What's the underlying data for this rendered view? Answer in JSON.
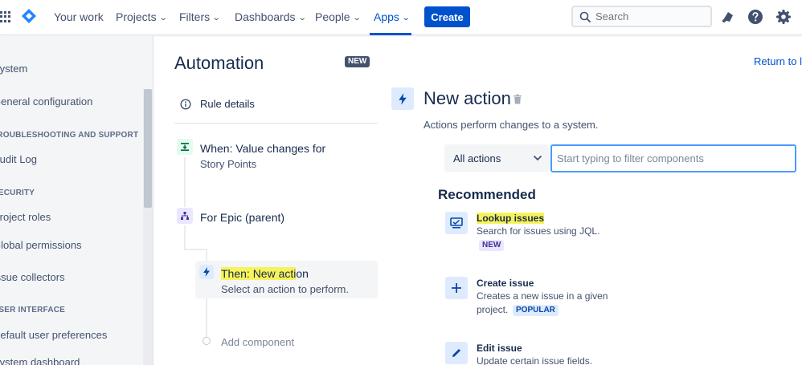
{
  "nav": {
    "your_work": "Your work",
    "projects": "Projects",
    "filters": "Filters",
    "dashboards": "Dashboards",
    "people": "People",
    "apps": "Apps",
    "create": "Create",
    "search_placeholder": "Search",
    "accent": "#0052cc"
  },
  "sidebar": {
    "title": "System",
    "items": [
      {
        "label": "General configuration"
      },
      {
        "section": "TROUBLESHOOTING AND SUPPORT"
      },
      {
        "label": "Audit Log"
      },
      {
        "section": "SECURITY"
      },
      {
        "label": "Project roles"
      },
      {
        "label": "Global permissions"
      },
      {
        "label": "Issue collectors"
      },
      {
        "section": "USER INTERFACE"
      },
      {
        "label": "Default user preferences"
      },
      {
        "label": "System dashboard"
      }
    ]
  },
  "automation": {
    "title": "Automation",
    "badge": "NEW",
    "rule_details": "Rule details",
    "steps": [
      {
        "title": "When: Value changes for",
        "subtitle": "Story Points"
      },
      {
        "title": "For Epic (parent)"
      },
      {
        "title_highlight": "Then: New acti",
        "title_rest": "on",
        "subtitle": "Select an action to perform."
      }
    ],
    "add_component": "Add component"
  },
  "panel": {
    "return_link": "Return to li",
    "title": "New action",
    "description": "Actions perform changes to a system.",
    "select_value": "All actions",
    "filter_placeholder": "Start typing to filter components",
    "recommended": "Recommended",
    "components": [
      {
        "name": "Lookup issues",
        "description": "Search for issues using JQL.",
        "badge": "NEW",
        "icon": "lookup-issues-icon"
      },
      {
        "name": "Create issue",
        "description_line1": "Creates a new issue in a given",
        "description_line2": "project.",
        "badge": "POPULAR",
        "icon": "plus-icon"
      },
      {
        "name": "Edit issue",
        "description": "Update certain issue fields.",
        "icon": "pencil-icon"
      }
    ]
  }
}
